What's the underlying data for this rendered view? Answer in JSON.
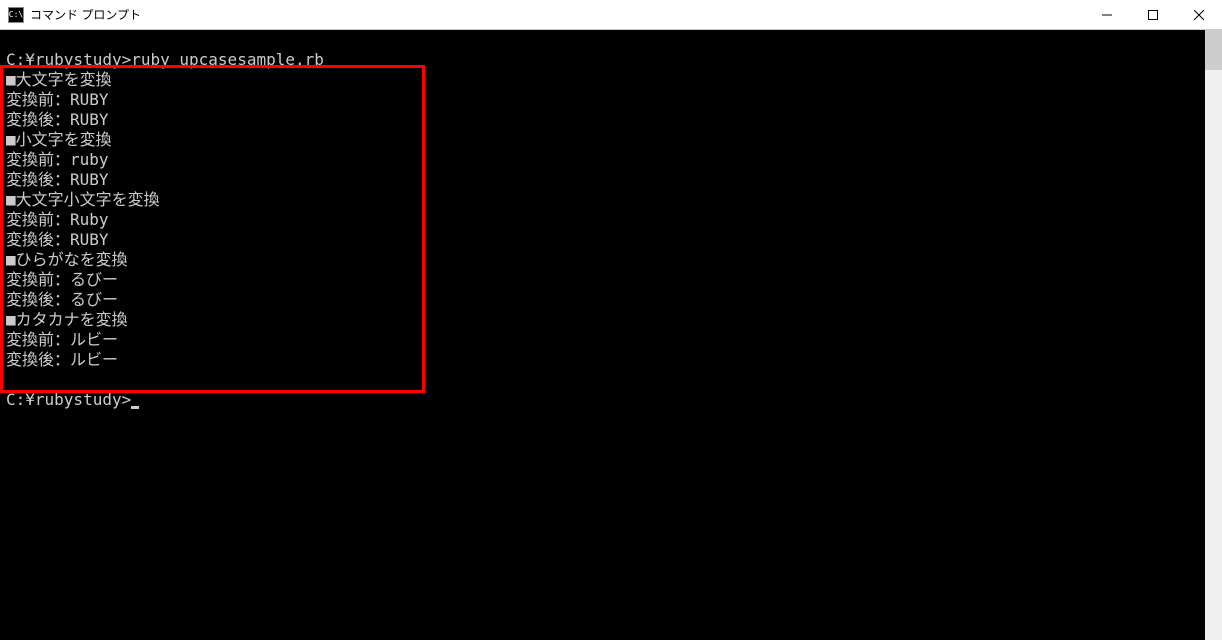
{
  "window": {
    "title": "コマンド プロンプト",
    "icon_text": "C:\\"
  },
  "terminal": {
    "lines": [
      "C:¥rubystudy>ruby upcasesample.rb",
      "■大文字を変換",
      "変換前：RUBY",
      "変換後：RUBY",
      "■小文字を変換",
      "変換前：ruby",
      "変換後：RUBY",
      "■大文字小文字を変換",
      "変換前：Ruby",
      "変換後：RUBY",
      "■ひらがなを変換",
      "変換前：るびー",
      "変換後：るびー",
      "■カタカナを変換",
      "変換前：ルビー",
      "変換後：ルビー"
    ],
    "prompt": "C:¥rubystudy>"
  }
}
